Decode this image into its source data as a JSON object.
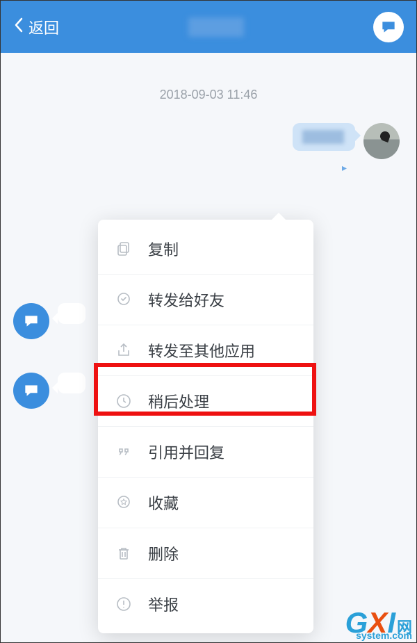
{
  "header": {
    "back_label": "返回"
  },
  "chat": {
    "timestamp": "2018-09-03 11:46"
  },
  "menu": {
    "items": [
      {
        "label": "复制",
        "icon": "copy-icon"
      },
      {
        "label": "转发给好友",
        "icon": "forward-friend-icon"
      },
      {
        "label": "转发至其他应用",
        "icon": "share-app-icon"
      },
      {
        "label": "稍后处理",
        "icon": "later-icon"
      },
      {
        "label": "引用并回复",
        "icon": "quote-reply-icon"
      },
      {
        "label": "收藏",
        "icon": "favorite-icon"
      },
      {
        "label": "删除",
        "icon": "delete-icon"
      },
      {
        "label": "举报",
        "icon": "report-icon"
      }
    ],
    "highlighted_index": 3
  },
  "watermark": {
    "brand": "GXI",
    "suffix": "网",
    "domain": "system.com"
  }
}
